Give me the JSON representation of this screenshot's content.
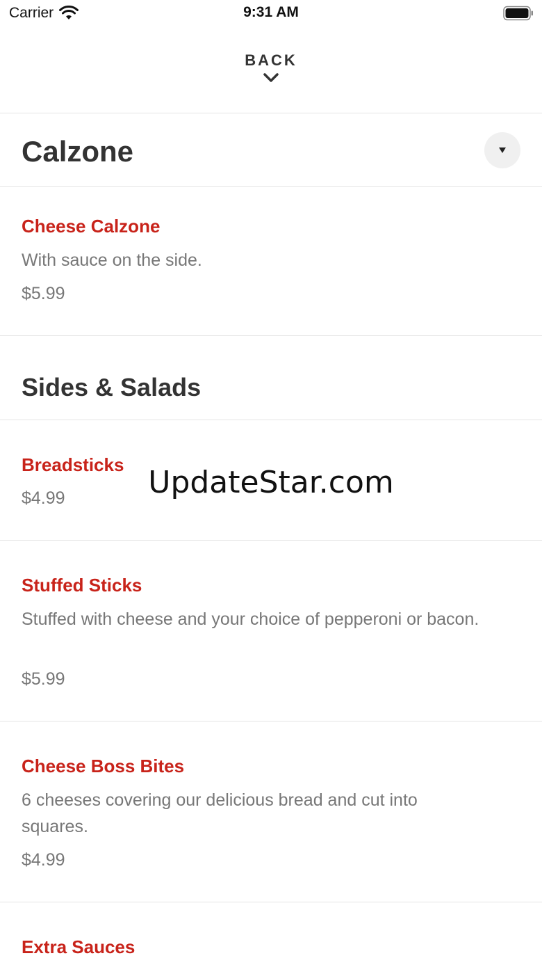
{
  "status_bar": {
    "carrier": "Carrier",
    "time": "9:31 AM",
    "wifi_icon": "wifi-icon",
    "battery_icon": "battery-full-icon"
  },
  "nav": {
    "back_label": "BACK",
    "back_icon": "chevron-down-icon"
  },
  "sections": [
    {
      "title": "Calzone",
      "toggle_icon": "caret-down-icon",
      "items": [
        {
          "name": "Cheese Calzone",
          "description": "With sauce on the side.",
          "price": "$5.99"
        }
      ]
    },
    {
      "title": "Sides & Salads",
      "items": [
        {
          "name": "Breadsticks",
          "description": "",
          "price": "$4.99"
        },
        {
          "name": "Stuffed Sticks",
          "description": "Stuffed with cheese and your choice of pepperoni or bacon.",
          "price": "$5.99"
        },
        {
          "name": "Cheese Boss Bites",
          "description": "6 cheeses covering our delicious bread and cut into squares.",
          "price": "$4.99"
        },
        {
          "name": "Extra Sauces",
          "description": "",
          "price": ""
        }
      ]
    }
  ],
  "watermark": "UpdateStar.com",
  "colors": {
    "item_name": "#c8231a",
    "secondary_text": "#777777",
    "heading_text": "#333333",
    "divider": "#e4e4e4"
  }
}
